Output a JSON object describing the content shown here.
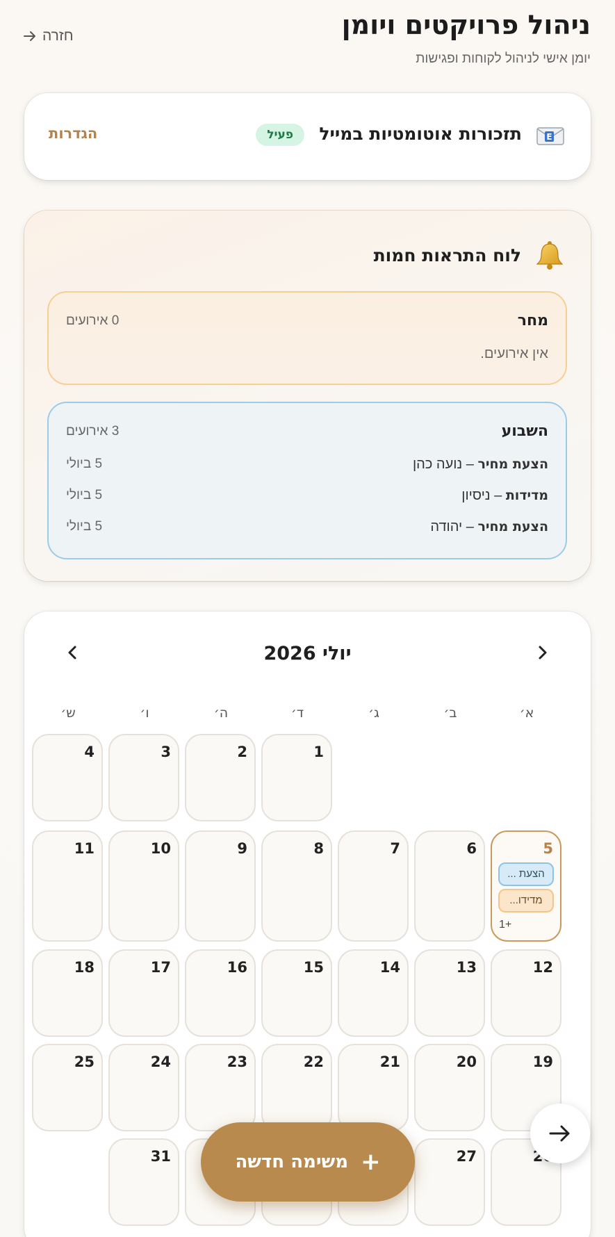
{
  "header": {
    "title": "ניהול פרויקטים ויומן",
    "subtitle": "יומן אישי לניהול לקוחות ופגישות",
    "back_label": "חזרה"
  },
  "email_reminders": {
    "icon": "envelope-icon",
    "title": "תזכורות אוטומטיות במייל",
    "status": "פעיל",
    "settings_label": "הגדרות",
    "status_color": "#d6f4e4"
  },
  "alerts": {
    "icon": "bell-icon",
    "title": "לוח התראות חמות",
    "tomorrow": {
      "heading": "מחר",
      "count": "0 אירועים",
      "empty": "אין אירועים."
    },
    "week": {
      "heading": "השבוע",
      "count": "3 אירועים",
      "events": [
        {
          "type": "הצעת מחיר",
          "sep": " – ",
          "name": "נועה כהן",
          "date": "5 ביולי"
        },
        {
          "type": "מדידות",
          "sep": " – ",
          "name": "ניסיון",
          "date": "5 ביולי"
        },
        {
          "type": "הצעת מחיר",
          "sep": " – ",
          "name": "יהודה",
          "date": "5 ביולי"
        }
      ]
    }
  },
  "calendar": {
    "month_label": "יולי 2026",
    "prev_icon": "chevron-right-icon",
    "next_icon": "chevron-left-icon",
    "weekdays": [
      "א׳",
      "ב׳",
      "ג׳",
      "ד׳",
      "ה׳",
      "ו׳",
      "ש׳"
    ],
    "today_day": "5",
    "today_events": [
      "הצעת ...",
      "מדידו..."
    ],
    "today_more": "+1",
    "accent": "#b5824a"
  },
  "fab": {
    "label": "משימה חדשה",
    "plus": "+"
  },
  "scroll_button_icon": "arrow-right-icon"
}
